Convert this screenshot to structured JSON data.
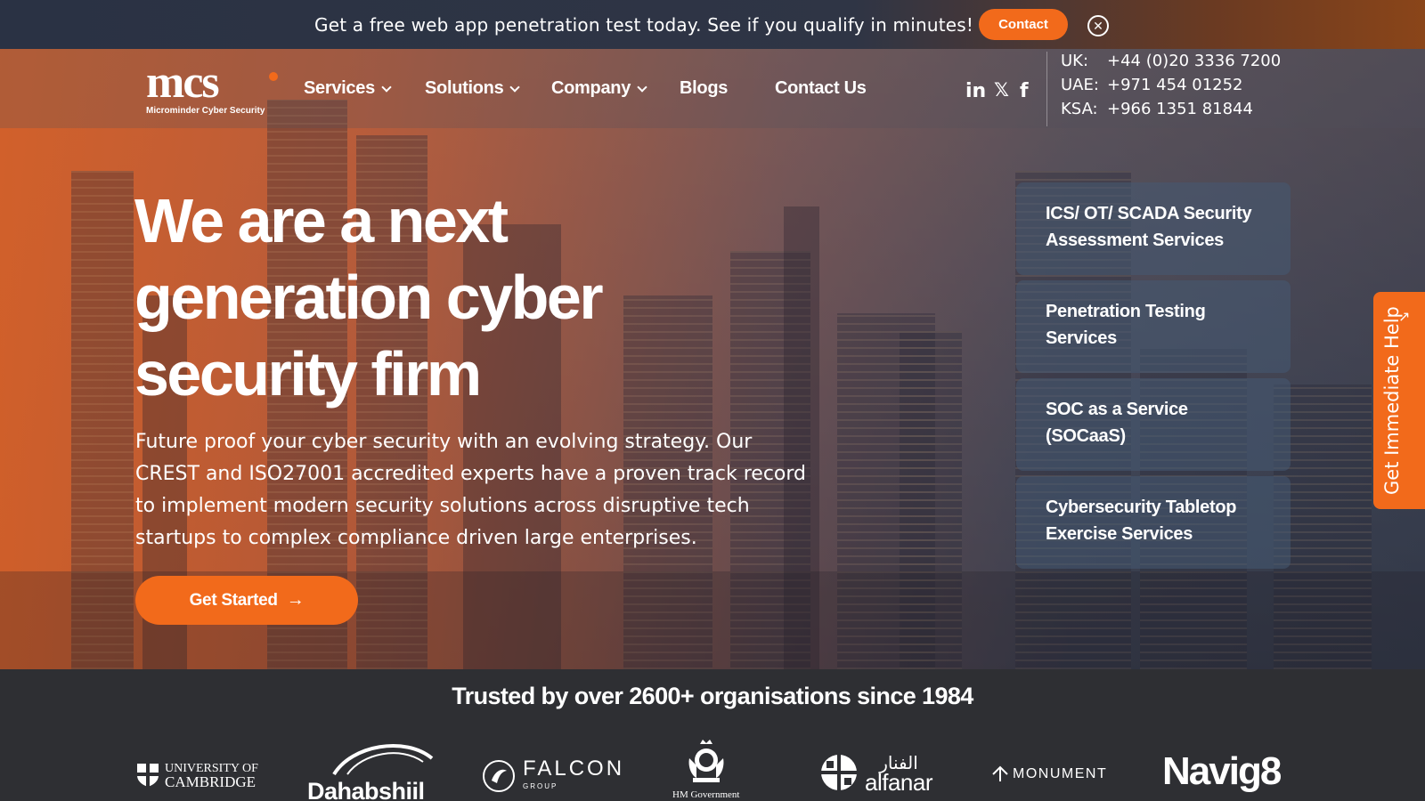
{
  "banner": {
    "text": "Get a free web app penetration test today. See if you qualify in minutes!",
    "contact_label": "Contact",
    "close_glyph": "✕"
  },
  "brand": {
    "logo_text": "mcs",
    "logo_sub": "Microminder Cyber Security",
    "accent": "#f26a1b"
  },
  "nav": {
    "items": [
      {
        "label": "Services",
        "dropdown": true
      },
      {
        "label": "Solutions",
        "dropdown": true
      },
      {
        "label": "Company",
        "dropdown": true
      },
      {
        "label": "Blogs",
        "dropdown": false
      },
      {
        "label": "Contact Us",
        "dropdown": false
      }
    ],
    "social": {
      "linkedin": "in",
      "x": "𝕏",
      "facebook": "f"
    },
    "phones": [
      {
        "region": "UK:",
        "number": "+44 (0)20 3336 7200"
      },
      {
        "region": "UAE:",
        "number": "+971 454 01252"
      },
      {
        "region": "KSA:",
        "number": "+966 1351 81844"
      }
    ]
  },
  "hero": {
    "title_line1": "We are a next",
    "title_line2": "generation cyber",
    "title_line3": "security firm",
    "description": "Future proof your cyber security with an evolving strategy. Our CREST and ISO27001 accredited experts have a proven track record to implement modern security solutions across disruptive tech startups to complex compliance driven large enterprises.",
    "cta_label": "Get Started",
    "cta_arrow": "→"
  },
  "services": {
    "cards": [
      "ICS/ OT/ SCADA Security Assessment Services",
      "Penetration Testing Services",
      "SOC as a Service (SOCaaS)",
      "Cybersecurity Tabletop Exercise Services"
    ]
  },
  "side_tab": {
    "label": "Get Immediate Help",
    "icon": "↗"
  },
  "trusted": {
    "title": "Trusted by over 2600+ organisations since 1984",
    "logos": {
      "cambridge_1": "UNIVERSITY OF",
      "cambridge_2": "CAMBRIDGE",
      "dahabshiil": "Dahabshiil",
      "falcon": "FALCON",
      "falcon_sub": "GROUP",
      "hmgov": "HM Government",
      "alfanar_ar": "الفنار",
      "alfanar": "alfanar",
      "monument": "MONUMENT",
      "navig8": "Navig8"
    }
  }
}
